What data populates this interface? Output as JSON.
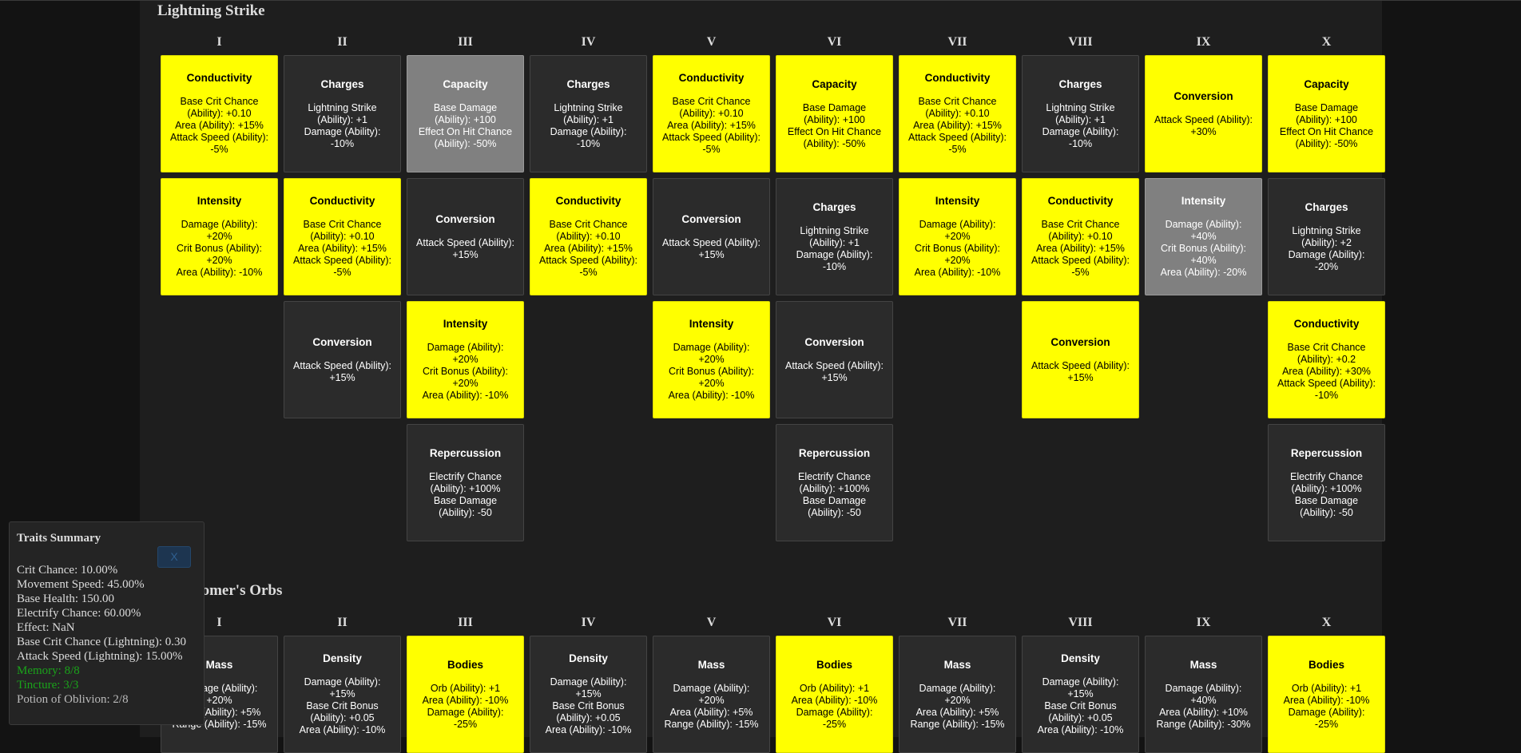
{
  "summary": {
    "title": "Traits Summary",
    "lines": [
      {
        "text": "Crit Chance: 10.00%",
        "style": "normal"
      },
      {
        "text": "Movement Speed: 45.00%",
        "style": "normal"
      },
      {
        "text": "Base Health: 150.00",
        "style": "normal"
      },
      {
        "text": "Electrify Chance: 60.00%",
        "style": "normal"
      },
      {
        "text": "Effect: NaN",
        "style": "normal"
      },
      {
        "text": "Base Crit Chance (Lightning): 0.30",
        "style": "normal"
      },
      {
        "text": "Attack Speed (Lightning): 15.00%",
        "style": "normal"
      },
      {
        "text": "Memory: 8/8",
        "style": "green"
      },
      {
        "text": "Tincture: 3/3",
        "style": "green"
      },
      {
        "text": "Potion of Oblivion: 2/8",
        "style": "dim"
      }
    ],
    "close_label": "X"
  },
  "colors": {
    "selected": "#ffff00",
    "unselected": "#2b2b2b",
    "locked": "#808080",
    "memory_text": "#1aa31a"
  },
  "columns": [
    "I",
    "II",
    "III",
    "IV",
    "V",
    "VI",
    "VII",
    "VIII",
    "IX",
    "X"
  ],
  "sections": [
    {
      "title": "Lightning Strike",
      "columns": [
        [
          {
            "name": "Conductivity",
            "desc": "Base Crit Chance\n(Ability): +0.10\nArea (Ability): +15%\nAttack Speed (Ability):\n-5%",
            "state": "yellow"
          },
          {
            "name": "Intensity",
            "desc": "Damage (Ability):\n+20%\nCrit Bonus (Ability):\n+20%\nArea (Ability): -10%",
            "state": "yellow"
          }
        ],
        [
          {
            "name": "Charges",
            "desc": "Lightning Strike\n(Ability): +1\nDamage (Ability):\n-10%",
            "state": "dark"
          },
          {
            "name": "Conductivity",
            "desc": "Base Crit Chance\n(Ability): +0.10\nArea (Ability): +15%\nAttack Speed (Ability):\n-5%",
            "state": "yellow"
          },
          {
            "name": "Conversion",
            "desc": "Attack Speed (Ability):\n+15%",
            "state": "dark"
          }
        ],
        [
          {
            "name": "Capacity",
            "desc": "Base Damage\n(Ability): +100\nEffect On Hit Chance\n(Ability): -50%",
            "state": "gray"
          },
          {
            "name": "Conversion",
            "desc": "Attack Speed (Ability):\n+15%",
            "state": "dark"
          },
          {
            "name": "Intensity",
            "desc": "Damage (Ability):\n+20%\nCrit Bonus (Ability):\n+20%\nArea (Ability): -10%",
            "state": "yellow"
          },
          {
            "name": "Repercussion",
            "desc": "Electrify Chance\n(Ability): +100%\nBase Damage\n(Ability): -50",
            "state": "dark"
          }
        ],
        [
          {
            "name": "Charges",
            "desc": "Lightning Strike\n(Ability): +1\nDamage (Ability):\n-10%",
            "state": "dark"
          },
          {
            "name": "Conductivity",
            "desc": "Base Crit Chance\n(Ability): +0.10\nArea (Ability): +15%\nAttack Speed (Ability):\n-5%",
            "state": "yellow"
          }
        ],
        [
          {
            "name": "Conductivity",
            "desc": "Base Crit Chance\n(Ability): +0.10\nArea (Ability): +15%\nAttack Speed (Ability):\n-5%",
            "state": "yellow"
          },
          {
            "name": "Conversion",
            "desc": "Attack Speed (Ability):\n+15%",
            "state": "dark"
          },
          {
            "name": "Intensity",
            "desc": "Damage (Ability):\n+20%\nCrit Bonus (Ability):\n+20%\nArea (Ability): -10%",
            "state": "yellow"
          }
        ],
        [
          {
            "name": "Capacity",
            "desc": "Base Damage\n(Ability): +100\nEffect On Hit Chance\n(Ability): -50%",
            "state": "yellow"
          },
          {
            "name": "Charges",
            "desc": "Lightning Strike\n(Ability): +1\nDamage (Ability):\n-10%",
            "state": "dark"
          },
          {
            "name": "Conversion",
            "desc": "Attack Speed (Ability):\n+15%",
            "state": "dark"
          },
          {
            "name": "Repercussion",
            "desc": "Electrify Chance\n(Ability): +100%\nBase Damage\n(Ability): -50",
            "state": "dark"
          }
        ],
        [
          {
            "name": "Conductivity",
            "desc": "Base Crit Chance\n(Ability): +0.10\nArea (Ability): +15%\nAttack Speed (Ability):\n-5%",
            "state": "yellow"
          },
          {
            "name": "Intensity",
            "desc": "Damage (Ability):\n+20%\nCrit Bonus (Ability):\n+20%\nArea (Ability): -10%",
            "state": "yellow"
          }
        ],
        [
          {
            "name": "Charges",
            "desc": "Lightning Strike\n(Ability): +1\nDamage (Ability):\n-10%",
            "state": "dark"
          },
          {
            "name": "Conductivity",
            "desc": "Base Crit Chance\n(Ability): +0.10\nArea (Ability): +15%\nAttack Speed (Ability):\n-5%",
            "state": "yellow"
          },
          {
            "name": "Conversion",
            "desc": "Attack Speed (Ability):\n+15%",
            "state": "yellow"
          }
        ],
        [
          {
            "name": "Conversion",
            "desc": "Attack Speed (Ability):\n+30%",
            "state": "yellow"
          },
          {
            "name": "Intensity",
            "desc": "Damage (Ability):\n+40%\nCrit Bonus (Ability):\n+40%\nArea (Ability): -20%",
            "state": "gray"
          }
        ],
        [
          {
            "name": "Capacity",
            "desc": "Base Damage\n(Ability): +100\nEffect On Hit Chance\n(Ability): -50%",
            "state": "yellow"
          },
          {
            "name": "Charges",
            "desc": "Lightning Strike\n(Ability): +2\nDamage (Ability):\n-20%",
            "state": "dark"
          },
          {
            "name": "Conductivity",
            "desc": "Base Crit Chance\n(Ability): +0.2\nArea (Ability): +30%\nAttack Speed (Ability):\n-10%",
            "state": "yellow"
          },
          {
            "name": "Repercussion",
            "desc": "Electrify Chance\n(Ability): +100%\nBase Damage\n(Ability): -50",
            "state": "dark"
          }
        ]
      ]
    },
    {
      "title": "Astronomer's Orbs",
      "columns": [
        [
          {
            "name": "Mass",
            "desc": "Damage (Ability):\n+20%\nArea (Ability): +5%\nRange (Ability): -15%",
            "state": "dark"
          }
        ],
        [
          {
            "name": "Density",
            "desc": "Damage (Ability):\n+15%\nBase Crit Bonus\n(Ability): +0.05\nArea (Ability): -10%",
            "state": "dark"
          }
        ],
        [
          {
            "name": "Bodies",
            "desc": "Orb (Ability): +1\nArea (Ability): -10%\nDamage (Ability):\n-25%",
            "state": "yellow"
          }
        ],
        [
          {
            "name": "Density",
            "desc": "Damage (Ability):\n+15%\nBase Crit Bonus\n(Ability): +0.05\nArea (Ability): -10%",
            "state": "dark"
          }
        ],
        [
          {
            "name": "Mass",
            "desc": "Damage (Ability):\n+20%\nArea (Ability): +5%\nRange (Ability): -15%",
            "state": "dark"
          }
        ],
        [
          {
            "name": "Bodies",
            "desc": "Orb (Ability): +1\nArea (Ability): -10%\nDamage (Ability):\n-25%",
            "state": "yellow"
          }
        ],
        [
          {
            "name": "Mass",
            "desc": "Damage (Ability):\n+20%\nArea (Ability): +5%\nRange (Ability): -15%",
            "state": "dark"
          }
        ],
        [
          {
            "name": "Density",
            "desc": "Damage (Ability):\n+15%\nBase Crit Bonus\n(Ability): +0.05\nArea (Ability): -10%",
            "state": "dark"
          }
        ],
        [
          {
            "name": "Mass",
            "desc": "Damage (Ability):\n+40%\nArea (Ability): +10%\nRange (Ability): -30%",
            "state": "dark"
          }
        ],
        [
          {
            "name": "Bodies",
            "desc": "Orb (Ability): +1\nArea (Ability): -10%\nDamage (Ability):\n-25%",
            "state": "yellow"
          }
        ]
      ]
    }
  ]
}
